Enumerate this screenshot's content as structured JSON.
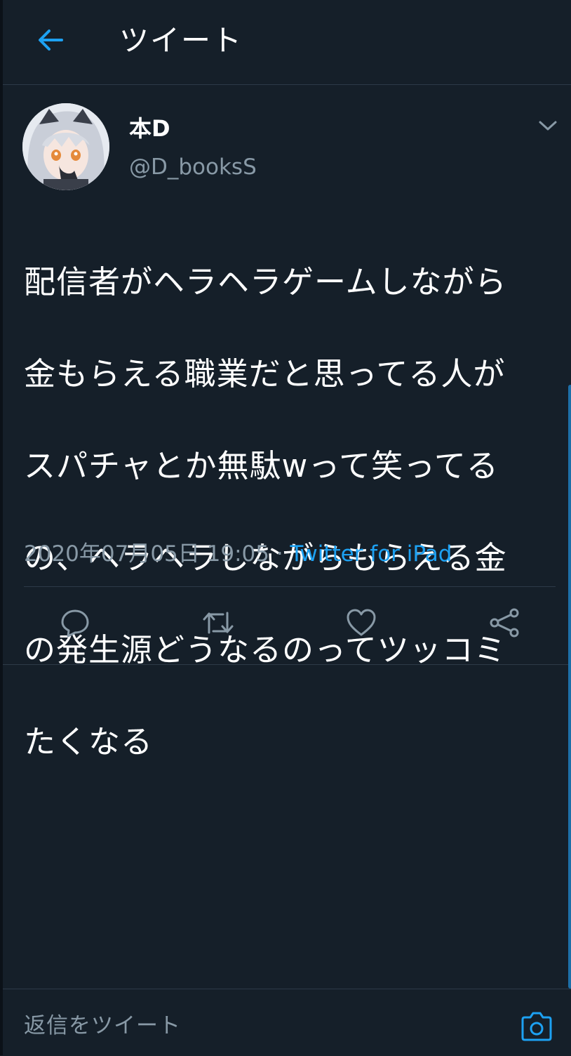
{
  "header": {
    "back_icon": "arrow-left-icon",
    "title": "ツイート"
  },
  "tweet": {
    "display_name": "本D",
    "handle": "@D_booksS",
    "text_lines": [
      "配信者がヘラヘラゲームしながら",
      "金もらえる職業だと思ってる人が",
      "スパチャとか無駄wって笑ってる",
      "の、ヘラヘラしながらもらえる金",
      "の発生源どうなるのってツッコミ",
      "たくなる"
    ],
    "timestamp": "2020年07月05日 19:05",
    "separator": " · ",
    "source": "Twitter for iPad",
    "menu_icon": "chevron-down-icon"
  },
  "actions": [
    {
      "name": "reply",
      "icon": "reply-icon"
    },
    {
      "name": "retweet",
      "icon": "retweet-icon"
    },
    {
      "name": "like",
      "icon": "heart-icon"
    },
    {
      "name": "share",
      "icon": "share-icon"
    }
  ],
  "reply_bar": {
    "placeholder": "返信をツイート",
    "camera_icon": "camera-icon"
  },
  "colors": {
    "background": "#151f29",
    "accent": "#1da1f2",
    "secondary_text": "#8899a6",
    "divider": "#2d3a48"
  }
}
